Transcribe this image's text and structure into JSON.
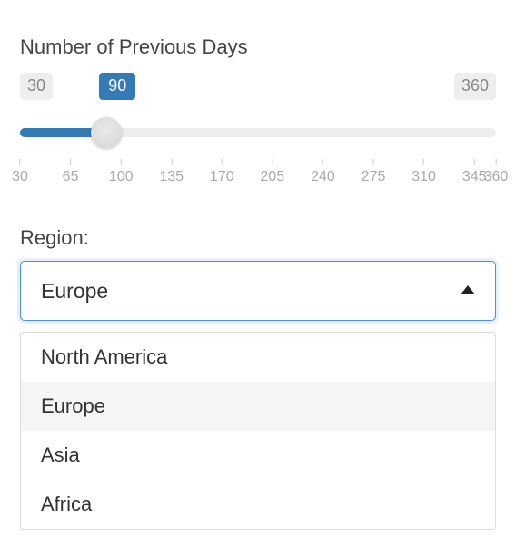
{
  "slider": {
    "label": "Number of Previous Days",
    "min": 30,
    "max": 360,
    "value": 90,
    "step_labels": [
      30,
      65,
      100,
      135,
      170,
      205,
      240,
      275,
      310,
      345,
      360
    ]
  },
  "region": {
    "label": "Region:",
    "selected": "Europe",
    "options": [
      "North America",
      "Europe",
      "Asia",
      "Africa"
    ]
  },
  "colors": {
    "accent": "#337ab7",
    "focus_border": "#4a90e2"
  },
  "icons": {
    "caret_up": "caret-up-icon"
  }
}
